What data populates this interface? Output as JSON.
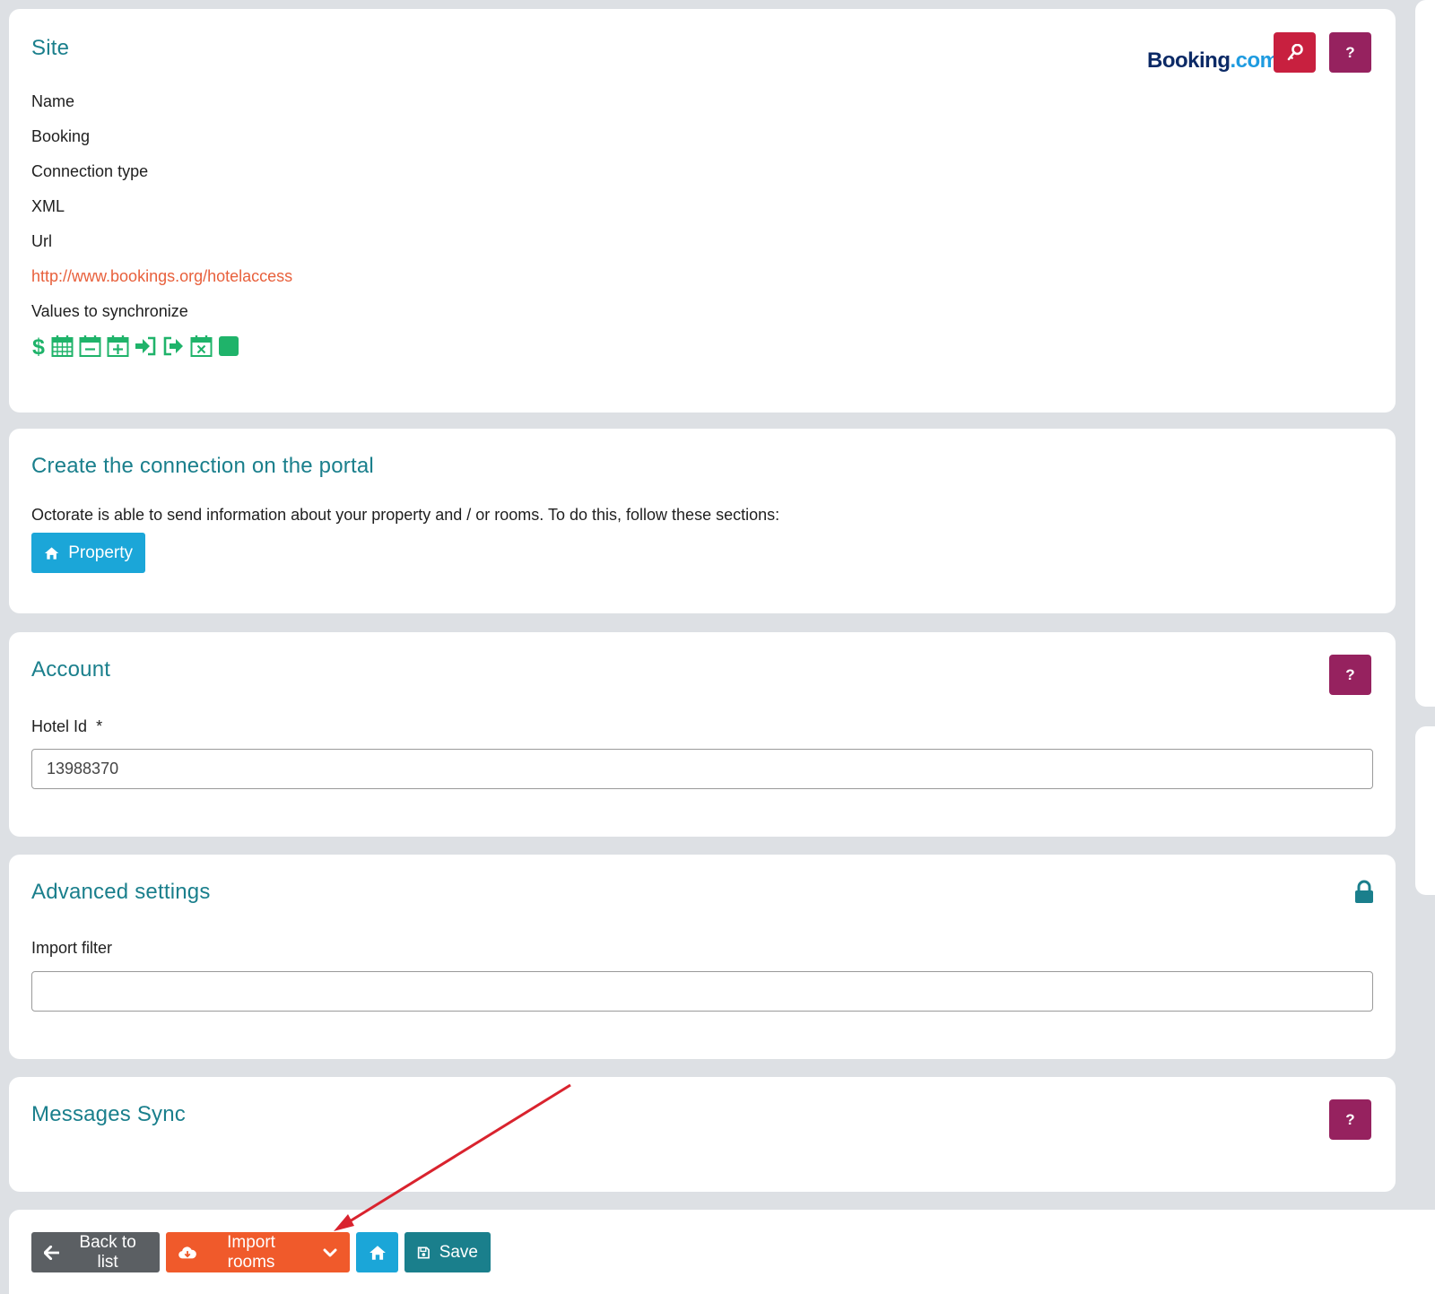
{
  "site": {
    "title": "Site",
    "brand": {
      "name": "Booking",
      "suffix": ".com"
    },
    "name_label": "Name",
    "name_value": "Booking",
    "connection_type_label": "Connection type",
    "connection_type_value": "XML",
    "url_label": "Url",
    "url_value": "http://www.bookings.org/hotelaccess",
    "values_label": "Values to synchronize",
    "sync_icons": [
      "dollar-icon",
      "calendar-grid-icon",
      "calendar-minus-icon",
      "calendar-plus-icon",
      "sign-in-icon",
      "sign-out-icon",
      "calendar-times-icon",
      "square-icon"
    ]
  },
  "connection": {
    "title": "Create the connection on the portal",
    "description": "Octorate is able to send information about your property and / or rooms. To do this, follow these sections:",
    "property_button": "Property"
  },
  "account": {
    "title": "Account",
    "hotel_id_label": "Hotel Id",
    "required_mark": "*",
    "hotel_id_value": "13988370"
  },
  "advanced": {
    "title": "Advanced settings",
    "import_filter_label": "Import filter",
    "import_filter_value": ""
  },
  "messages": {
    "title": "Messages Sync"
  },
  "footer": {
    "back_label": "Back to list",
    "import_label": "Import rooms",
    "save_label": "Save"
  },
  "help_label": "?",
  "colors": {
    "accent_teal": "#1a7f8c",
    "help_purple": "#96225f",
    "key_red": "#c8203f",
    "import_orange": "#f05a2b",
    "property_blue": "#1ba6d8",
    "sync_green": "#1fb36a",
    "back_gray": "#5b5f63"
  }
}
